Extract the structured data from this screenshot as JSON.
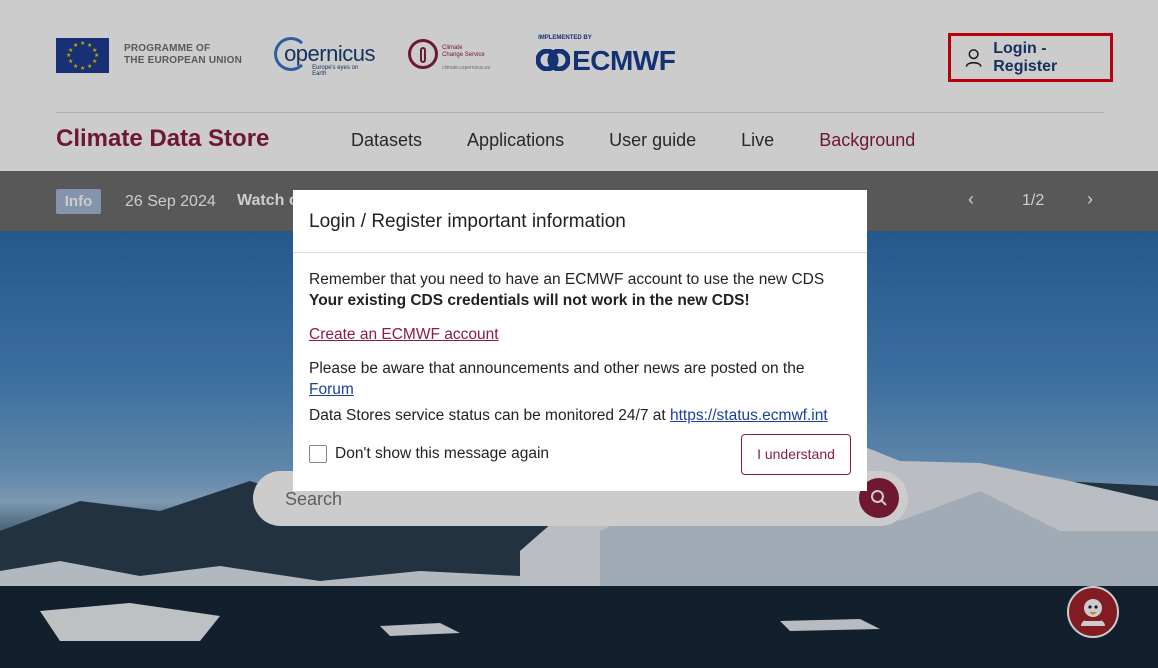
{
  "header": {
    "eu_text_line1": "PROGRAMME OF",
    "eu_text_line2": "THE EUROPEAN UNION",
    "copernicus_word": "opernicus",
    "copernicus_tag": "Europe's eyes on Earth",
    "c3s_line1": "Climate",
    "c3s_line2": "Change Service",
    "c3s_url": "climate.copernicus.eu",
    "ecmwf_impl": "IMPLEMENTED BY",
    "ecmwf_word": "ECMWF",
    "login_label": "Login - Register",
    "site_title": "Climate Data Store",
    "nav": [
      "Datasets",
      "Applications",
      "User guide",
      "Live",
      "Background"
    ]
  },
  "infobar": {
    "badge": "Info",
    "date": "26 Sep 2024",
    "text": "Watch o",
    "prev": "‹",
    "count": "1/2",
    "next": "›"
  },
  "search": {
    "placeholder": "Search"
  },
  "modal": {
    "title": "Login / Register important information",
    "line1": "Remember that you need to have an ECMWF account to use the new CDS",
    "line2": "Your existing CDS credentials will not work in the new CDS!",
    "create_link": "Create an ECMWF account",
    "forum_text": "Please be aware that announcements and other news are posted on the ",
    "forum_link": "Forum",
    "status_text": "Data Stores service status can be monitored 24/7 at ",
    "status_link": "https://status.ecmwf.int",
    "checkbox_label": "Don't show this message again",
    "button": "I understand"
  },
  "colors": {
    "brand": "#8b1e3f",
    "navy": "#1c3f76",
    "highlight": "#e8000d"
  },
  "icons": {
    "user": "user-icon",
    "search": "search-icon",
    "chat": "chat-bot-icon"
  }
}
